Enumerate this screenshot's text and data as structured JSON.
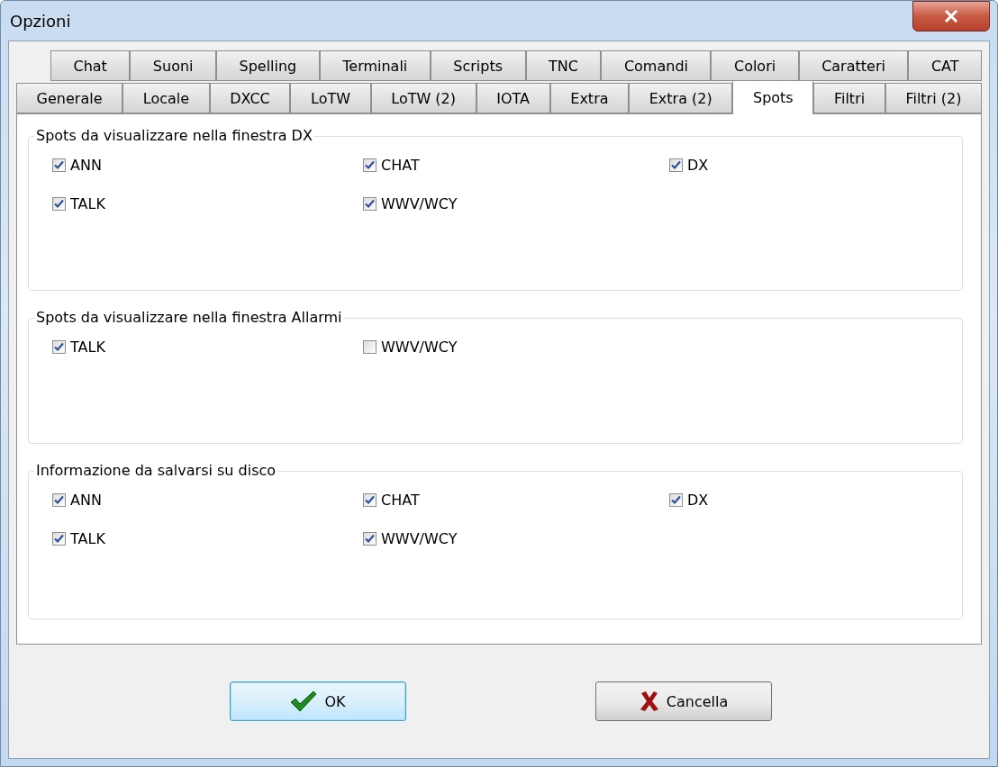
{
  "window": {
    "title": "Opzioni"
  },
  "tab_rows": [
    [
      {
        "label": "Chat",
        "selected": false
      },
      {
        "label": "Suoni",
        "selected": false
      },
      {
        "label": "Spelling",
        "selected": false
      },
      {
        "label": "Terminali",
        "selected": false
      },
      {
        "label": "Scripts",
        "selected": false
      },
      {
        "label": "TNC",
        "selected": false
      },
      {
        "label": "Comandi",
        "selected": false
      },
      {
        "label": "Colori",
        "selected": false
      },
      {
        "label": "Caratteri",
        "selected": false
      },
      {
        "label": "CAT",
        "selected": false
      }
    ],
    [
      {
        "label": "Generale",
        "selected": false
      },
      {
        "label": "Locale",
        "selected": false
      },
      {
        "label": "DXCC",
        "selected": false
      },
      {
        "label": "LoTW",
        "selected": false
      },
      {
        "label": "LoTW (2)",
        "selected": false
      },
      {
        "label": "IOTA",
        "selected": false
      },
      {
        "label": "Extra",
        "selected": false
      },
      {
        "label": "Extra (2)",
        "selected": false
      },
      {
        "label": "Spots",
        "selected": true
      },
      {
        "label": "Filtri",
        "selected": false
      },
      {
        "label": "Filtri (2)",
        "selected": false
      }
    ]
  ],
  "groups": [
    {
      "title": "Spots da visualizzare nella finestra DX",
      "options": [
        {
          "label": "ANN",
          "checked": true
        },
        {
          "label": "CHAT",
          "checked": true
        },
        {
          "label": "DX",
          "checked": true
        },
        {
          "label": "TALK",
          "checked": true
        },
        {
          "label": "WWV/WCY",
          "checked": true
        }
      ]
    },
    {
      "title": "Spots da visualizzare nella finestra Allarmi",
      "options": [
        {
          "label": "TALK",
          "checked": true
        },
        {
          "label": "WWV/WCY",
          "checked": false
        }
      ]
    },
    {
      "title": "Informazione da salvarsi su disco",
      "options": [
        {
          "label": "ANN",
          "checked": true
        },
        {
          "label": "CHAT",
          "checked": true
        },
        {
          "label": "DX",
          "checked": true
        },
        {
          "label": "TALK",
          "checked": true
        },
        {
          "label": "WWV/WCY",
          "checked": true
        }
      ]
    }
  ],
  "buttons": [
    {
      "label": "OK",
      "kind": "ok",
      "focused": true
    },
    {
      "label": "Cancella",
      "kind": "cancel",
      "focused": false
    }
  ]
}
